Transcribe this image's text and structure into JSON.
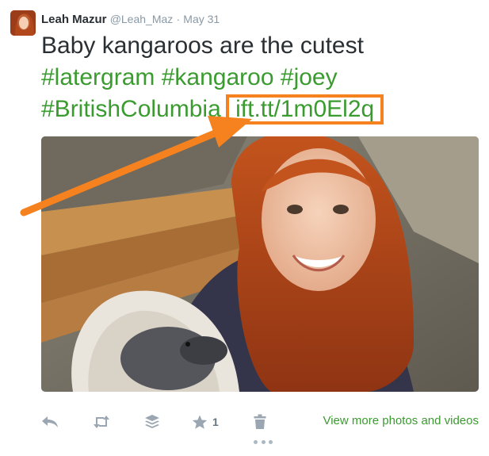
{
  "tweet": {
    "author": {
      "name": "Leah Mazur",
      "handle": "@Leah_Maz",
      "separator": "·",
      "time": "May 31"
    },
    "text_main": "Baby kangaroos are the cutest",
    "hashtags": [
      "#latergram",
      "#kangaroo",
      "#joey",
      "#BritishColumbia"
    ],
    "link": "ift.tt/1m0El2q",
    "photo_icon": "photo-of-woman-holding-joey"
  },
  "actions": {
    "reply_icon": "reply-icon",
    "retweet_icon": "retweet-icon",
    "buffer_icon": "buffer-icon",
    "favorite_icon": "star-icon",
    "favorite_count": "1",
    "delete_icon": "trash-icon",
    "view_more": "View more photos and videos",
    "more_icon": "more-dots-icon"
  },
  "colors": {
    "link_green": "#3a9b2f",
    "annotation_orange": "#f5811f",
    "name_text": "#292f33",
    "meta_gray": "#8899a6"
  }
}
